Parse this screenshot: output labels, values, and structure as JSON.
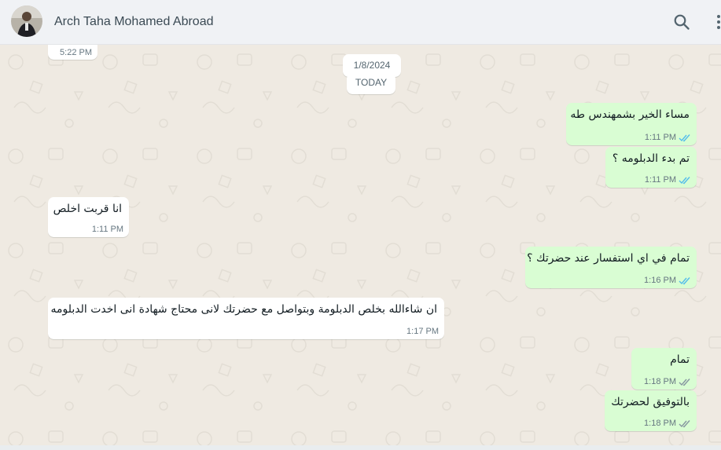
{
  "header": {
    "contact_name": "Arch Taha Mohamed Abroad"
  },
  "top_partial_time": "5:22 PM",
  "date_divider": {
    "date": "1/8/2024",
    "label": "TODAY"
  },
  "messages": [
    {
      "direction": "out",
      "text": "مساء الخير بشمهندس طه",
      "time": "1:11 PM",
      "status": "read"
    },
    {
      "direction": "out",
      "text": "تم بدء الدبلومه ؟",
      "time": "1:11 PM",
      "status": "read"
    },
    {
      "direction": "in",
      "text": "انا قربت اخلص",
      "time": "1:11 PM"
    },
    {
      "direction": "out",
      "text": "تمام في اي استفسار عند حضرتك ؟",
      "time": "1:16 PM",
      "status": "read"
    },
    {
      "direction": "in",
      "text": "ان شاءالله بخلص الدبلومة وبتواصل مع حضرتك لانى محتاج شهادة انى اخدت الدبلومه",
      "time": "1:17 PM"
    },
    {
      "direction": "out",
      "text": "تمام",
      "time": "1:18 PM",
      "status": "delivered"
    },
    {
      "direction": "out",
      "text": "بالتوفيق لحضرتك",
      "time": "1:18 PM",
      "status": "delivered"
    }
  ],
  "colors": {
    "read_tick": "#53bdeb",
    "delivered_tick": "#8696a0",
    "outgoing_bubble": "#d9fdd3",
    "incoming_bubble": "#ffffff",
    "chat_background": "#efeae2"
  },
  "icons": {
    "search": "search-icon",
    "menu": "menu-icon"
  }
}
